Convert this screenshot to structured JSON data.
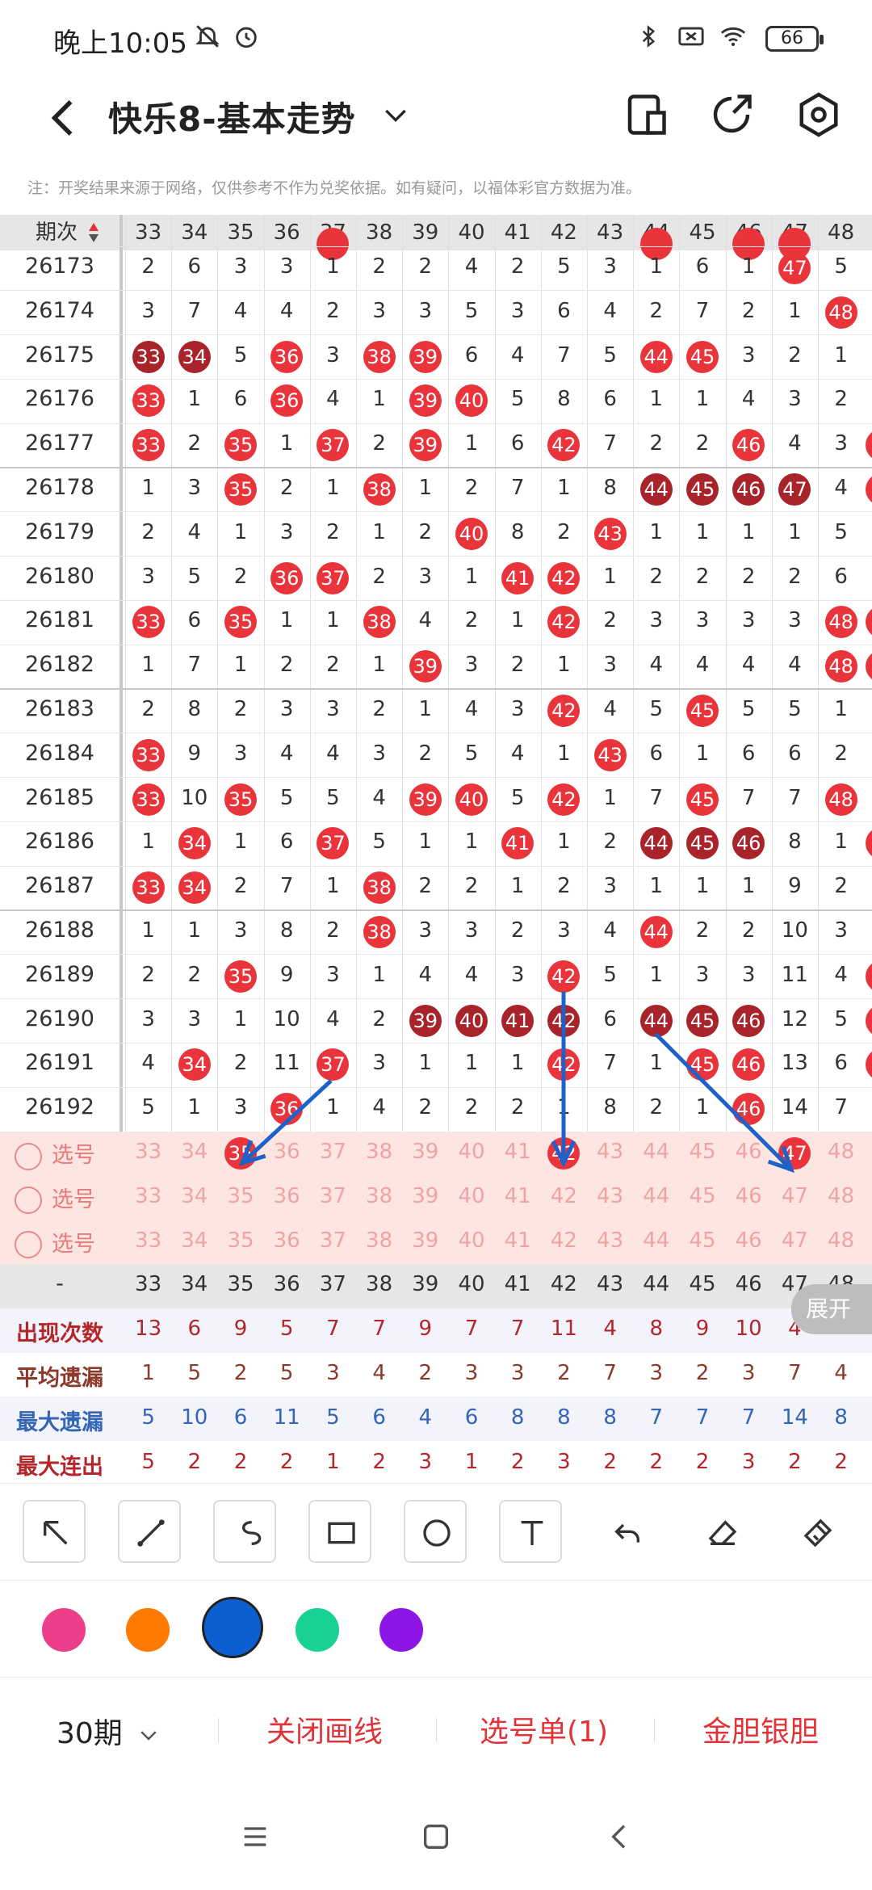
{
  "status": {
    "time": "晚上10:05",
    "battery": "66"
  },
  "header": {
    "title": "快乐8-基本走势"
  },
  "note": "注：开奖结果来源于网络，仅供参考不作为兑奖依据。如有疑问，以福体彩官方数据为准。",
  "grid": {
    "issue_header": "期次",
    "columns": [
      "33",
      "34",
      "35",
      "36",
      "37",
      "38",
      "39",
      "40",
      "41",
      "42",
      "43",
      "44",
      "45",
      "46",
      "47",
      "48"
    ],
    "rows": [
      {
        "issue": "26173",
        "cells": [
          "2",
          "6",
          "3",
          "3",
          "1",
          "2",
          "2",
          "4",
          "2",
          "5",
          "3",
          "1",
          "6",
          "1",
          "47",
          "5"
        ]
      },
      {
        "issue": "26174",
        "cells": [
          "3",
          "7",
          "4",
          "4",
          "2",
          "3",
          "3",
          "5",
          "3",
          "6",
          "4",
          "2",
          "7",
          "2",
          "1",
          "48"
        ]
      },
      {
        "issue": "26175",
        "cells": [
          "33",
          "34",
          "5",
          "36",
          "3",
          "38",
          "39",
          "6",
          "4",
          "7",
          "5",
          "44",
          "45",
          "3",
          "2",
          "1"
        ]
      },
      {
        "issue": "26176",
        "cells": [
          "33",
          "1",
          "6",
          "36",
          "4",
          "1",
          "39",
          "40",
          "5",
          "8",
          "6",
          "1",
          "1",
          "4",
          "3",
          "2"
        ]
      },
      {
        "issue": "26177",
        "cells": [
          "33",
          "2",
          "35",
          "1",
          "37",
          "2",
          "39",
          "1",
          "6",
          "42",
          "7",
          "2",
          "2",
          "46",
          "4",
          "3"
        ]
      },
      {
        "issue": "26178",
        "cells": [
          "1",
          "3",
          "35",
          "2",
          "1",
          "38",
          "1",
          "2",
          "7",
          "1",
          "8",
          "44",
          "45",
          "46",
          "47",
          "4"
        ]
      },
      {
        "issue": "26179",
        "cells": [
          "2",
          "4",
          "1",
          "3",
          "2",
          "1",
          "2",
          "40",
          "8",
          "2",
          "43",
          "1",
          "1",
          "1",
          "1",
          "5"
        ]
      },
      {
        "issue": "26180",
        "cells": [
          "3",
          "5",
          "2",
          "36",
          "37",
          "2",
          "3",
          "1",
          "41",
          "42",
          "1",
          "2",
          "2",
          "2",
          "2",
          "6"
        ]
      },
      {
        "issue": "26181",
        "cells": [
          "33",
          "6",
          "35",
          "1",
          "1",
          "38",
          "4",
          "2",
          "1",
          "42",
          "2",
          "3",
          "3",
          "3",
          "3",
          "48"
        ]
      },
      {
        "issue": "26182",
        "cells": [
          "1",
          "7",
          "1",
          "2",
          "2",
          "1",
          "39",
          "3",
          "2",
          "1",
          "3",
          "4",
          "4",
          "4",
          "4",
          "48"
        ]
      },
      {
        "issue": "26183",
        "cells": [
          "2",
          "8",
          "2",
          "3",
          "3",
          "2",
          "1",
          "4",
          "3",
          "42",
          "4",
          "5",
          "45",
          "5",
          "5",
          "1"
        ]
      },
      {
        "issue": "26184",
        "cells": [
          "33",
          "9",
          "3",
          "4",
          "4",
          "3",
          "2",
          "5",
          "4",
          "1",
          "43",
          "6",
          "1",
          "6",
          "6",
          "2"
        ]
      },
      {
        "issue": "26185",
        "cells": [
          "33",
          "10",
          "35",
          "5",
          "5",
          "4",
          "39",
          "40",
          "5",
          "42",
          "1",
          "7",
          "45",
          "7",
          "7",
          "48"
        ]
      },
      {
        "issue": "26186",
        "cells": [
          "1",
          "34",
          "1",
          "6",
          "37",
          "5",
          "1",
          "1",
          "41",
          "1",
          "2",
          "44",
          "45",
          "46",
          "8",
          "1"
        ]
      },
      {
        "issue": "26187",
        "cells": [
          "33",
          "34",
          "2",
          "7",
          "1",
          "38",
          "2",
          "2",
          "1",
          "2",
          "3",
          "1",
          "1",
          "1",
          "9",
          "2"
        ]
      },
      {
        "issue": "26188",
        "cells": [
          "1",
          "1",
          "3",
          "8",
          "2",
          "38",
          "3",
          "3",
          "2",
          "3",
          "4",
          "44",
          "2",
          "2",
          "10",
          "3"
        ]
      },
      {
        "issue": "26189",
        "cells": [
          "2",
          "2",
          "35",
          "9",
          "3",
          "1",
          "4",
          "4",
          "3",
          "42",
          "5",
          "1",
          "3",
          "3",
          "11",
          "4"
        ]
      },
      {
        "issue": "26190",
        "cells": [
          "3",
          "3",
          "1",
          "10",
          "4",
          "2",
          "39",
          "40",
          "41",
          "42",
          "6",
          "44",
          "45",
          "46",
          "12",
          "5"
        ]
      },
      {
        "issue": "26191",
        "cells": [
          "4",
          "34",
          "2",
          "11",
          "37",
          "3",
          "1",
          "1",
          "1",
          "42",
          "7",
          "1",
          "45",
          "46",
          "13",
          "6"
        ]
      },
      {
        "issue": "26192",
        "cells": [
          "5",
          "1",
          "3",
          "36",
          "1",
          "4",
          "2",
          "2",
          "2",
          "1",
          "8",
          "2",
          "1",
          "46",
          "14",
          "7"
        ]
      }
    ],
    "select_label": "选号",
    "select_rows": [
      {
        "selected": [
          "35",
          "42",
          "47"
        ]
      },
      {
        "selected": []
      },
      {
        "selected": []
      }
    ],
    "footer_dash": "-",
    "stats": [
      {
        "label": "出现次数",
        "color": "#b3262c",
        "values": [
          "13",
          "6",
          "9",
          "5",
          "7",
          "7",
          "9",
          "7",
          "7",
          "11",
          "4",
          "8",
          "9",
          "10",
          "4",
          ""
        ]
      },
      {
        "label": "平均遗漏",
        "color": "#8a3a2a",
        "values": [
          "1",
          "5",
          "2",
          "5",
          "3",
          "4",
          "2",
          "3",
          "3",
          "2",
          "7",
          "3",
          "2",
          "3",
          "7",
          "4"
        ]
      },
      {
        "label": "最大遗漏",
        "color": "#3565b5",
        "values": [
          "5",
          "10",
          "6",
          "11",
          "5",
          "6",
          "4",
          "6",
          "8",
          "8",
          "8",
          "7",
          "7",
          "7",
          "14",
          "8"
        ]
      },
      {
        "label": "最大连出",
        "color": "#b3262c",
        "values": [
          "5",
          "2",
          "2",
          "2",
          "1",
          "2",
          "3",
          "1",
          "2",
          "3",
          "2",
          "2",
          "2",
          "3",
          "2",
          "2"
        ]
      }
    ],
    "expand_label": "展开"
  },
  "tools": [
    "arrow-tool",
    "line-tool",
    "curve-tool",
    "rect-tool",
    "circle-tool",
    "text-tool",
    "undo-tool",
    "eraser-tool",
    "clear-tool"
  ],
  "colors": [
    "#ec3f8a",
    "#ff7a00",
    "#0c5fd0",
    "#18d294",
    "#8b16e6"
  ],
  "selected_color": "#0c5fd0",
  "bottom": {
    "period": "30期",
    "close_line": "关闭画线",
    "pick_list": "选号单(1)",
    "golden": "金胆银胆"
  },
  "arrow_color": "#1e62c9"
}
